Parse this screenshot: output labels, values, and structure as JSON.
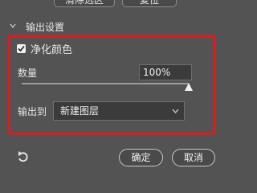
{
  "top_buttons": {
    "clear_label": "清除选区",
    "reset_label": "复位"
  },
  "output_settings": {
    "section_title": "输出设置",
    "decontaminate_colors": {
      "label": "净化颜色",
      "checked": true
    },
    "amount": {
      "label": "数量",
      "value": "100%",
      "level": 1.0
    },
    "output_to": {
      "label": "输出到",
      "selected": "新建图层"
    }
  },
  "footer": {
    "ok_label": "确定",
    "cancel_label": "取消"
  },
  "icons": {
    "collapse": "chevron-down-icon",
    "reset": "undo-arrow-icon",
    "dropdown": "chevron-down-icon",
    "check": "checkmark-icon"
  },
  "colors": {
    "highlight_border": "#e01b1b"
  }
}
